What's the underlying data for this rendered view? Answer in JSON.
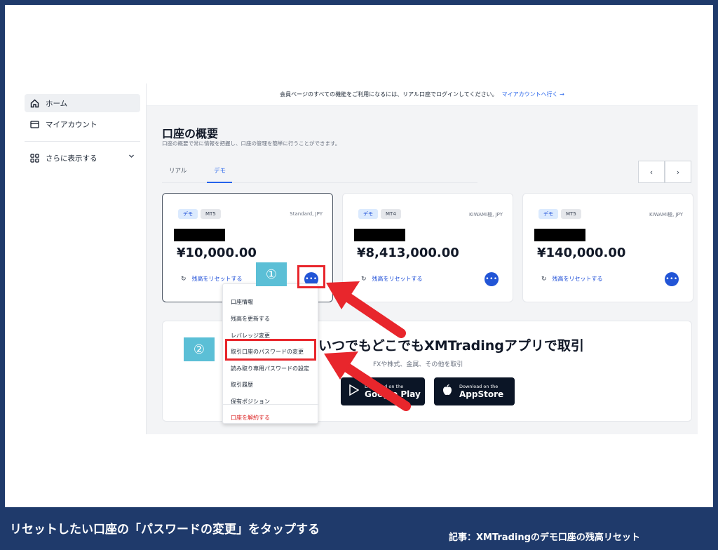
{
  "sidebar": {
    "items": [
      {
        "label": "ホーム",
        "icon": "home-icon"
      },
      {
        "label": "マイアカウント",
        "icon": "card-icon"
      },
      {
        "label": "さらに表示する",
        "icon": "grid-icon"
      }
    ]
  },
  "banner": {
    "text": "会員ページのすべての機能をご利用になるには、リアル口座でログインしてください。",
    "link": "マイアカウントへ行く →"
  },
  "page": {
    "title": "口座の概要",
    "subtitle": "口座の概要で常に情報を把握し、口座の管理を簡単に行うことができます。"
  },
  "tabs": [
    {
      "label": "リアル"
    },
    {
      "label": "デモ"
    }
  ],
  "pager": {
    "prev": "‹",
    "next": "›"
  },
  "accounts": [
    {
      "tag": "デモ",
      "platform": "MT5",
      "type": "Standard, JPY",
      "balance": "¥10,000.00",
      "reset": "残高をリセットする"
    },
    {
      "tag": "デモ",
      "platform": "MT4",
      "type": "KIWAMI極, JPY",
      "balance": "¥8,413,000.00",
      "reset": "残高をリセットする"
    },
    {
      "tag": "デモ",
      "platform": "MT5",
      "type": "KIWAMI極, JPY",
      "balance": "¥140,000.00",
      "reset": "残高をリセットする"
    }
  ],
  "promo": {
    "title": "いつでもどこでもXMTradingアプリで取引",
    "subtitle": "FXや株式、金属、その他を取引",
    "google": {
      "small": "Download on the",
      "big": "Google Play"
    },
    "apple": {
      "small": "Download on the",
      "big": "AppStore"
    }
  },
  "menu": {
    "items": [
      {
        "label": "口座情報"
      },
      {
        "label": "残高を更新する"
      },
      {
        "label": "レバレッジ変更"
      },
      {
        "label": "取引口座のパスワードの変更"
      },
      {
        "label": "読み取り専用パスワードの設定"
      },
      {
        "label": "取引履歴"
      },
      {
        "label": "保有ポジション"
      }
    ],
    "danger": "口座を解約する"
  },
  "annotations": {
    "step1": "①",
    "step2": "②",
    "color": "#e8262c",
    "step_color": "#5bbfd6"
  },
  "caption": "リセットしたい口座の「パスワードの変更」をタップする",
  "credit": "記事：XMTradingのデモ口座の残高リセット"
}
